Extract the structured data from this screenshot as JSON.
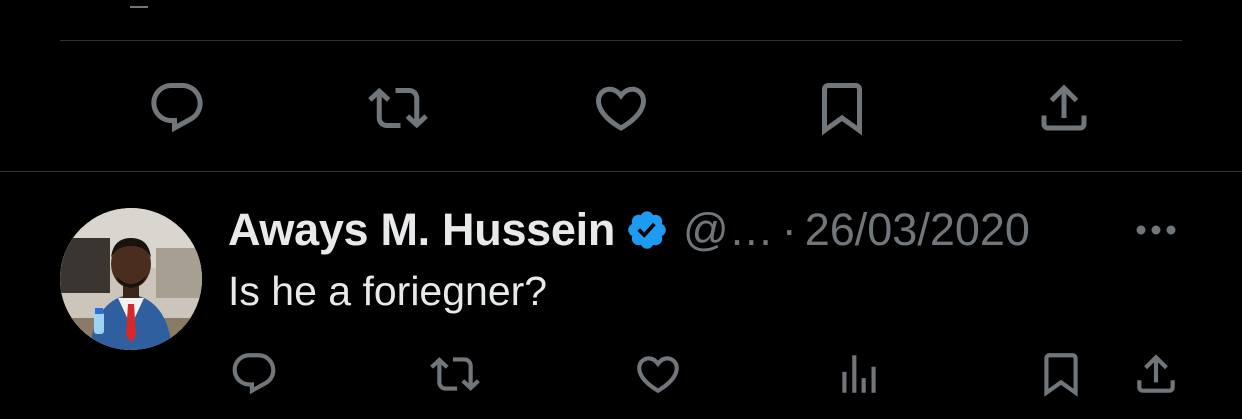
{
  "top_tweet": {
    "actions": [
      {
        "name": "reply-button",
        "icon": "reply-icon"
      },
      {
        "name": "retweet-button",
        "icon": "retweet-icon"
      },
      {
        "name": "like-button",
        "icon": "heart-icon"
      },
      {
        "name": "bookmark-button",
        "icon": "bookmark-icon"
      },
      {
        "name": "share-button",
        "icon": "share-icon"
      }
    ]
  },
  "reply": {
    "author": {
      "display_name": "Aways M. Hussein",
      "verified": true,
      "handle": "@…",
      "avatar_icon": "profile-photo"
    },
    "separator": "·",
    "timestamp": "26/03/2020",
    "text": "Is he a foriegner?",
    "more_icon": "more-icon",
    "actions": [
      {
        "name": "reply-button",
        "icon": "reply-icon"
      },
      {
        "name": "retweet-button",
        "icon": "retweet-icon"
      },
      {
        "name": "like-button",
        "icon": "heart-icon"
      },
      {
        "name": "views-button",
        "icon": "views-chart-icon"
      },
      {
        "name": "bookmark-button",
        "icon": "bookmark-icon"
      },
      {
        "name": "share-button",
        "icon": "share-icon"
      }
    ]
  },
  "colors": {
    "background": "#000000",
    "text_primary": "#e7e9ea",
    "text_secondary": "#71767b",
    "verified_blue": "#1d9bf0",
    "divider": "#2f3336"
  }
}
